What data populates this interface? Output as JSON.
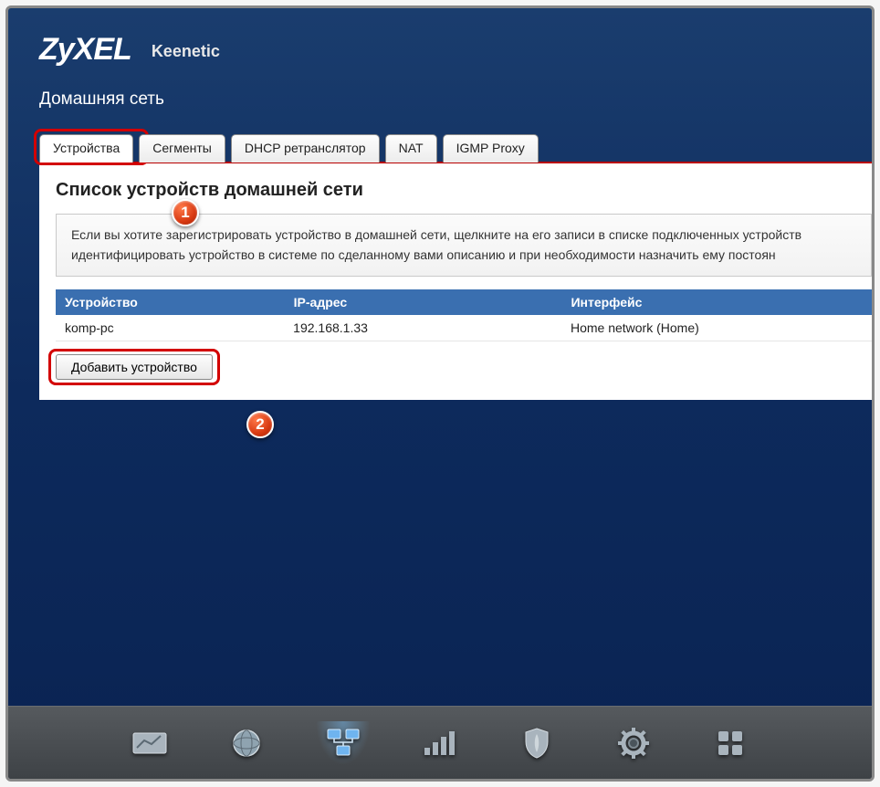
{
  "brand": {
    "name": "ZyXEL",
    "product": "Keenetic"
  },
  "page": {
    "title": "Домашняя сеть"
  },
  "tabs": [
    {
      "label": "Устройства",
      "active": true
    },
    {
      "label": "Сегменты",
      "active": false
    },
    {
      "label": "DHCP ретранслятор",
      "active": false
    },
    {
      "label": "NAT",
      "active": false
    },
    {
      "label": "IGMP Proxy",
      "active": false
    }
  ],
  "section": {
    "heading": "Список устройств домашней сети",
    "info": "Если вы хотите зарегистрировать устройство в домашней сети, щелкните на его записи в списке подключенных устройств идентифицировать устройство в системе по сделанному вами описанию и при необходимости назначить ему постоян"
  },
  "table": {
    "headers": {
      "device": "Устройство",
      "ip": "IP-адрес",
      "iface": "Интерфейс"
    },
    "rows": [
      {
        "device": "komp-pc",
        "ip": "192.168.1.33",
        "iface": "Home network (Home)"
      }
    ]
  },
  "buttons": {
    "add_device": "Добавить устройство"
  },
  "annotations": {
    "badge1": "1",
    "badge2": "2"
  },
  "dock_icons": [
    "graph-icon",
    "globe-icon",
    "network-icon",
    "signal-icon",
    "shield-icon",
    "gear-icon",
    "apps-icon"
  ],
  "colors": {
    "panel_bg": "#ffffff",
    "accent_blue": "#3a6fb0",
    "highlight": "#d30000"
  }
}
